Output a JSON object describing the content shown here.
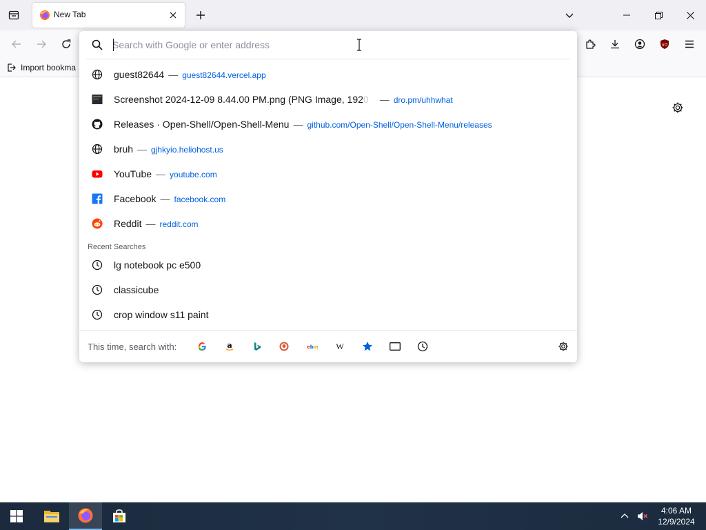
{
  "tab": {
    "title": "New Tab"
  },
  "urlbar": {
    "placeholder": "Search with Google or enter address"
  },
  "bookmarks": {
    "import_label": "Import bookma"
  },
  "results": [
    {
      "icon": "globe-icon",
      "title": "guest82644",
      "url": "guest82644.vercel.app"
    },
    {
      "icon": "image-thumbnail-icon",
      "title": "Screenshot 2024-12-09 8.44.00 PM.png (PNG Image, 192",
      "title_fade": "0",
      "url": "dro.pm/uhhwhat"
    },
    {
      "icon": "github-icon",
      "title": "Releases · Open-Shell/Open-Shell-Menu",
      "url": "github.com/Open-Shell/Open-Shell-Menu/releases"
    },
    {
      "icon": "globe-icon",
      "title": "bruh",
      "url": "gjhkyio.heliohost.us"
    },
    {
      "icon": "youtube-icon",
      "title": "YouTube",
      "url": "youtube.com"
    },
    {
      "icon": "facebook-icon",
      "title": "Facebook",
      "url": "facebook.com"
    },
    {
      "icon": "reddit-icon",
      "title": "Reddit",
      "url": "reddit.com"
    }
  ],
  "separator": "—",
  "recent_searches": {
    "label": "Recent Searches",
    "items": [
      "lg notebook pc e500",
      "classicube",
      "crop window s11 paint"
    ]
  },
  "one_off": {
    "label": "This time, search with:",
    "engines": [
      "google-icon",
      "amazon-icon",
      "bing-icon",
      "duckduckgo-icon",
      "ebay-icon",
      "wikipedia-icon",
      "bookmarks-star-icon",
      "tabs-icon",
      "history-icon"
    ]
  },
  "clock": {
    "time": "4:06 AM",
    "date": "12/9/2024"
  },
  "colors": {
    "link": "#0061e0",
    "taskbar": "#1b2a3d",
    "accent_blue": "#0060df"
  }
}
